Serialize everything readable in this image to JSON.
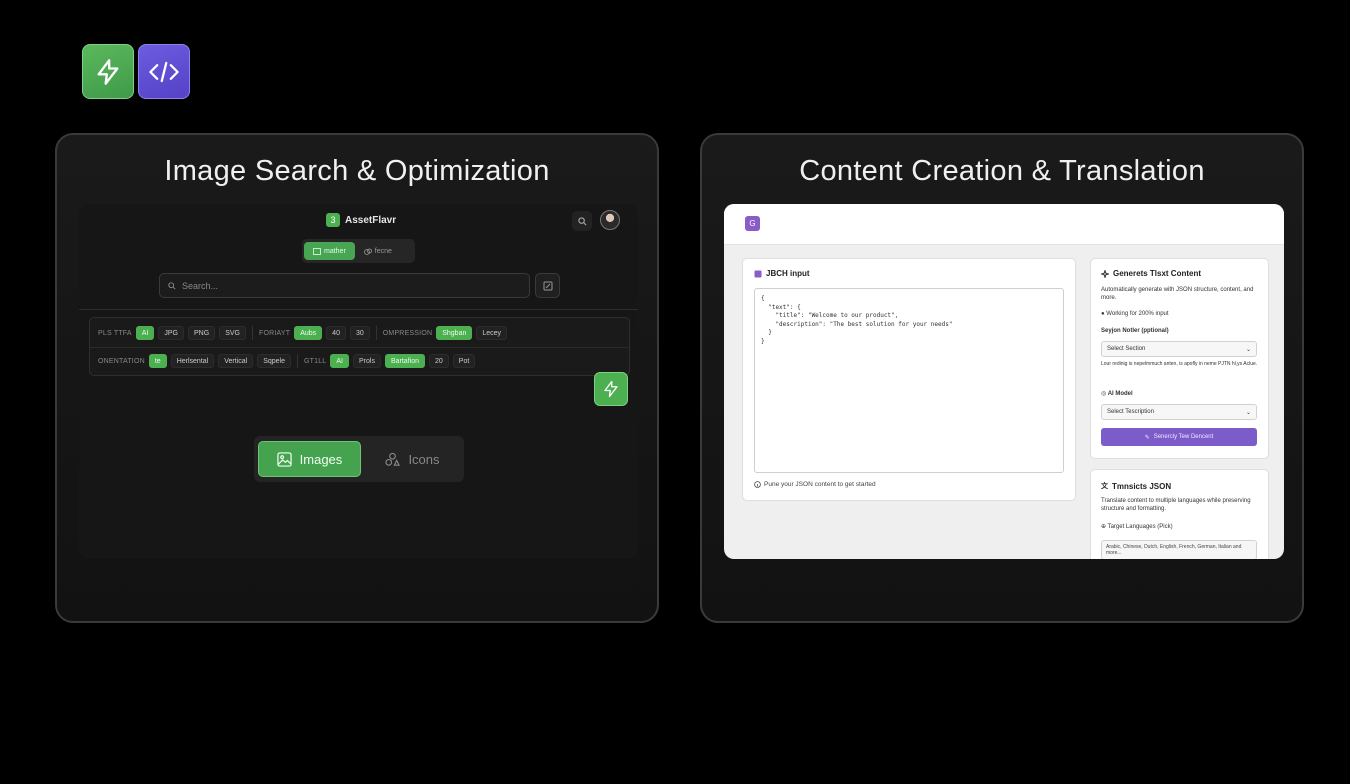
{
  "left_panel": {
    "title": "Image Search & Optimization",
    "app": {
      "brand_badge": "3",
      "brand_name": "AssetFlavr",
      "top_tabs": [
        {
          "label": "mather"
        },
        {
          "label": "fecne"
        }
      ],
      "search_placeholder": "Search...",
      "filters": {
        "row1": {
          "file_type_label": "PLS TTFA",
          "file_types": [
            "AI",
            "JPG",
            "PNG",
            "SVG"
          ],
          "format_label": "FORIAYT",
          "formats": [
            "Aubs",
            "40",
            "30"
          ],
          "compression_label": "OMPRESSION",
          "compressions": [
            "Shgban",
            "Lecey"
          ]
        },
        "row2": {
          "orientation_label": "ONENTATION",
          "orientations": [
            "te",
            "Herlsental",
            "Vertical",
            "Sqpele"
          ],
          "style_label": "GT1LL",
          "styles": [
            "AI",
            "Prols",
            "Bartafion",
            "20",
            "Pot"
          ]
        }
      },
      "bottom_tabs": [
        {
          "label": "Images"
        },
        {
          "label": "Icons"
        }
      ]
    }
  },
  "right_panel": {
    "title": "Content Creation & Translation",
    "app": {
      "logo_letter": "G",
      "json_card": {
        "title": "JBCH input",
        "code": "{\n  \"text\": {\n    \"title\": \"Welcome to our product\",\n    \"description\": \"The best solution for your needs\"\n  }\n}",
        "hint": "Pune your JSON content to get started"
      },
      "generate_card": {
        "title": "Generets Tlsxt Content",
        "desc": "Automatically generate with JSON structure, content, and more.",
        "bullet": "Working for 200% input",
        "section_label": "Seyjon Notler (pptional)",
        "section_select": "Select Section",
        "section_help": "Lour redinig is nepelmmuch anten, is apofly in neme PJTN hl,ys Aclue.",
        "ai_label": "AI Model",
        "description_select": "Select Tescription",
        "button": "Senercly Tew Dencent"
      },
      "translate_card": {
        "title": "Tmnsicts JSON",
        "desc": "Translate content to multiple languages while preserving structure and formatting.",
        "lang_label": "Target Languages (Pick)",
        "lang_input": "Arabic, Chinese, Dutch, English, French, German, Italian and more..."
      }
    }
  }
}
